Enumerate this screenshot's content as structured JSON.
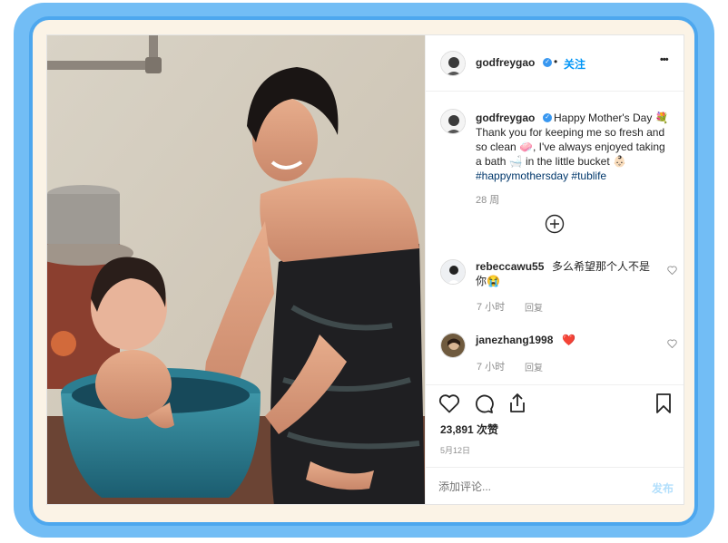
{
  "post": {
    "username": "godfreygao",
    "verified_mark": "✓",
    "separator": "•",
    "follow_label": "关注",
    "more_icon": "more-horizontal-icon",
    "more_label": "•••"
  },
  "caption": {
    "username": "godfreygao",
    "line1": "Happy Mother's Day 💐",
    "line2": "Thank you for keeping me so fresh and",
    "line3": "so clean 🧼, I've always enjoyed taking",
    "line4": "a bath 🛁 in the little bucket 👶🏻",
    "hashtags": "#happymothersday #tublife",
    "time": "28 周"
  },
  "comments": [
    {
      "username": "rebeccawu55",
      "text_line1": "多么希望那个人不是",
      "text_line2": "你😭",
      "time": "7 小时",
      "reply": "回复"
    },
    {
      "username": "janezhang1998",
      "text": "❤️",
      "time": "7 小时",
      "reply": "回复"
    }
  ],
  "stats": {
    "likes": "23,891 次赞",
    "date": "5月12日"
  },
  "comment_box": {
    "placeholder": "添加评论...",
    "post_label": "发布"
  },
  "colors": {
    "frame": "#72bdf5",
    "frame_border": "#4da7ee",
    "background_cream": "#fbf3e6",
    "link_blue": "#0095f6"
  }
}
